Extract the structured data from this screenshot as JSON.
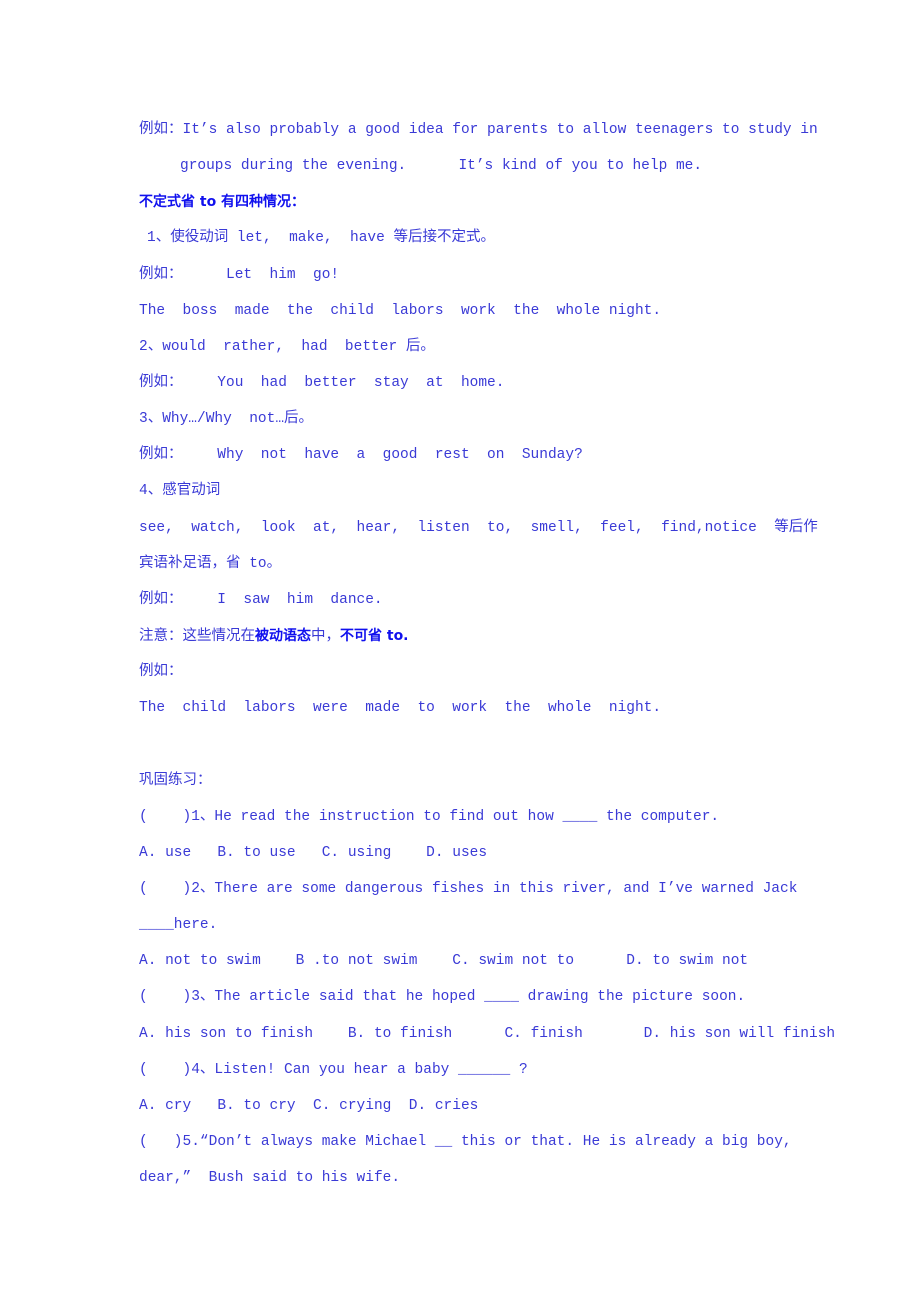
{
  "document": {
    "lines": [
      {
        "id": "example-intro-1",
        "text": "例如：It’s also probably a good idea for parents to allow teenagers to study in"
      },
      {
        "id": "example-intro-2",
        "text": "groups during the evening.      It’s kind of you to help me."
      },
      {
        "id": "section-heading",
        "text": "不定式省 to 有四种情况："
      },
      {
        "id": "case-1-title",
        "text": "1、使役动词 let,  make,  have 等后接不定式。"
      },
      {
        "id": "case-1-example",
        "text": "例如：     Let  him  go!"
      },
      {
        "id": "case-1-sentence",
        "text": "The  boss  made  the  child  labors  work  the  whole night."
      },
      {
        "id": "case-2-title",
        "text": "2、would  rather,  had  better 后。"
      },
      {
        "id": "case-2-example",
        "text": "例如：    You  had  better  stay  at  home."
      },
      {
        "id": "case-3-title",
        "text": "3、Why…/Why  not…后。"
      },
      {
        "id": "case-3-example",
        "text": "例如：    Why  not  have  a  good  rest  on  Sunday?"
      },
      {
        "id": "case-4-title",
        "text": "4、感官动词"
      },
      {
        "id": "case-4-verbs",
        "text": "see,  watch,  look  at,  hear,  listen  to,  smell,  feel,  find,notice  等后作"
      },
      {
        "id": "case-4-verbs-cont",
        "text": "宾语补足语，省 to。"
      },
      {
        "id": "case-4-example",
        "text": "例如：    I  saw  him  dance."
      },
      {
        "id": "note-prefix",
        "text": "注意：这些情况在",
        "bold1": "被动语态",
        "mid": "中，",
        "bold2": "不可省 to."
      },
      {
        "id": "note-example-label",
        "text": "例如："
      },
      {
        "id": "note-example-sentence",
        "text": "The  child  labors  were  made  to  work  the  whole  night."
      },
      {
        "id": "blank-line",
        "text": ""
      },
      {
        "id": "exercise-heading",
        "text": "巩固练习："
      }
    ],
    "exercises": [
      {
        "number": "1",
        "question_lines": [
          "(    )1、He read the instruction to find out how ____ the computer."
        ],
        "options": "A. use   B. to use   C. using    D. uses"
      },
      {
        "number": "2",
        "question_lines": [
          "(    )2、There are some dangerous fishes in this river, and I’ve warned Jack",
          "____here."
        ],
        "options": "A. not to swim    B .to not swim    C. swim not to      D. to swim not"
      },
      {
        "number": "3",
        "question_lines": [
          "(    )3、The article said that he hoped ____ drawing the picture soon."
        ],
        "options": "A. his son to finish    B. to finish      C. finish       D. his son will finish"
      },
      {
        "number": "4",
        "question_lines": [
          "(    )4、Listen! Can you hear a baby ______ ?"
        ],
        "options": "A. cry   B. to cry  C. crying  D. cries"
      },
      {
        "number": "5",
        "question_lines": [
          "(   )5.“Don’t always make Michael __ this or that. He is already a big boy,",
          "dear,”  Bush said to his wife."
        ],
        "options": null
      }
    ]
  },
  "colors": {
    "text": "#3a3ad6",
    "emphasis": "#1010ee",
    "background": "#ffffff"
  }
}
